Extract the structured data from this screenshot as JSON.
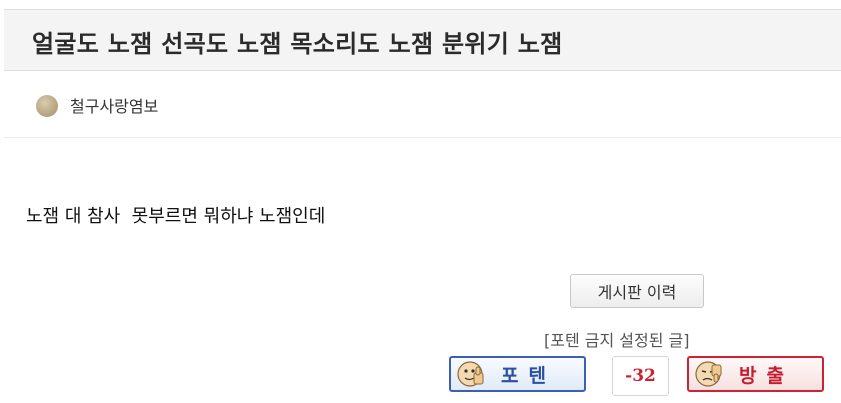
{
  "post": {
    "title": "얼굴도 노잼 선곡도 노잼 목소리도 노잼 분위기 노잼",
    "author": "철구사랑염보",
    "body": "노잼 대 참사  못부르면 뭐하냐 노잼인데"
  },
  "actions": {
    "history_label": "게시판 이력",
    "notice": "[포텐 금지 설정된 글]",
    "vote_up_label": "포텐",
    "vote_count": "-32",
    "vote_down_label": "방출"
  },
  "icons": {
    "vote_up": "thumbs-up-face-icon",
    "vote_down": "thumbs-down-face-icon",
    "author": "user-level-dot-icon"
  },
  "colors": {
    "vote_up_accent": "#3a5fb5",
    "vote_down_accent": "#cc2233",
    "vote_count": "#cc2233"
  }
}
